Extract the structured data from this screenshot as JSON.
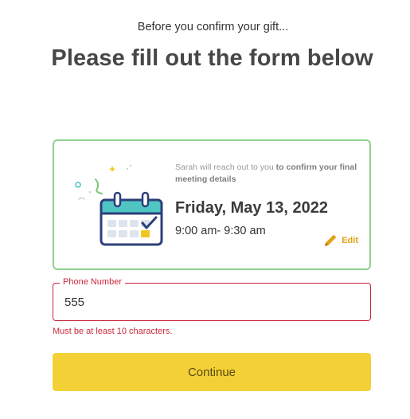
{
  "header": {
    "subtitle": "Before you confirm your gift...",
    "title": "Please fill out the form below"
  },
  "meeting_card": {
    "note_plain": "Sarah will reach out to you ",
    "note_bold": "to confirm your final meeting details",
    "date": "Friday, May 13, 2022",
    "time": "9:00 am- 9:30 am",
    "edit_label": "Edit",
    "illustration_icon": "calendar-check-icon",
    "edit_icon": "pencil-icon"
  },
  "form": {
    "phone_label": "Phone Number",
    "phone_value": "555",
    "phone_error": "Must be at least 10 characters."
  },
  "actions": {
    "continue_label": "Continue"
  },
  "colors": {
    "card_border": "#8fd18f",
    "error": "#c8283c",
    "accent_yellow": "#f3d136",
    "edit_orange": "#e3a21a",
    "calendar_teal": "#4fc6c4",
    "calendar_navy": "#2d3f7a"
  }
}
